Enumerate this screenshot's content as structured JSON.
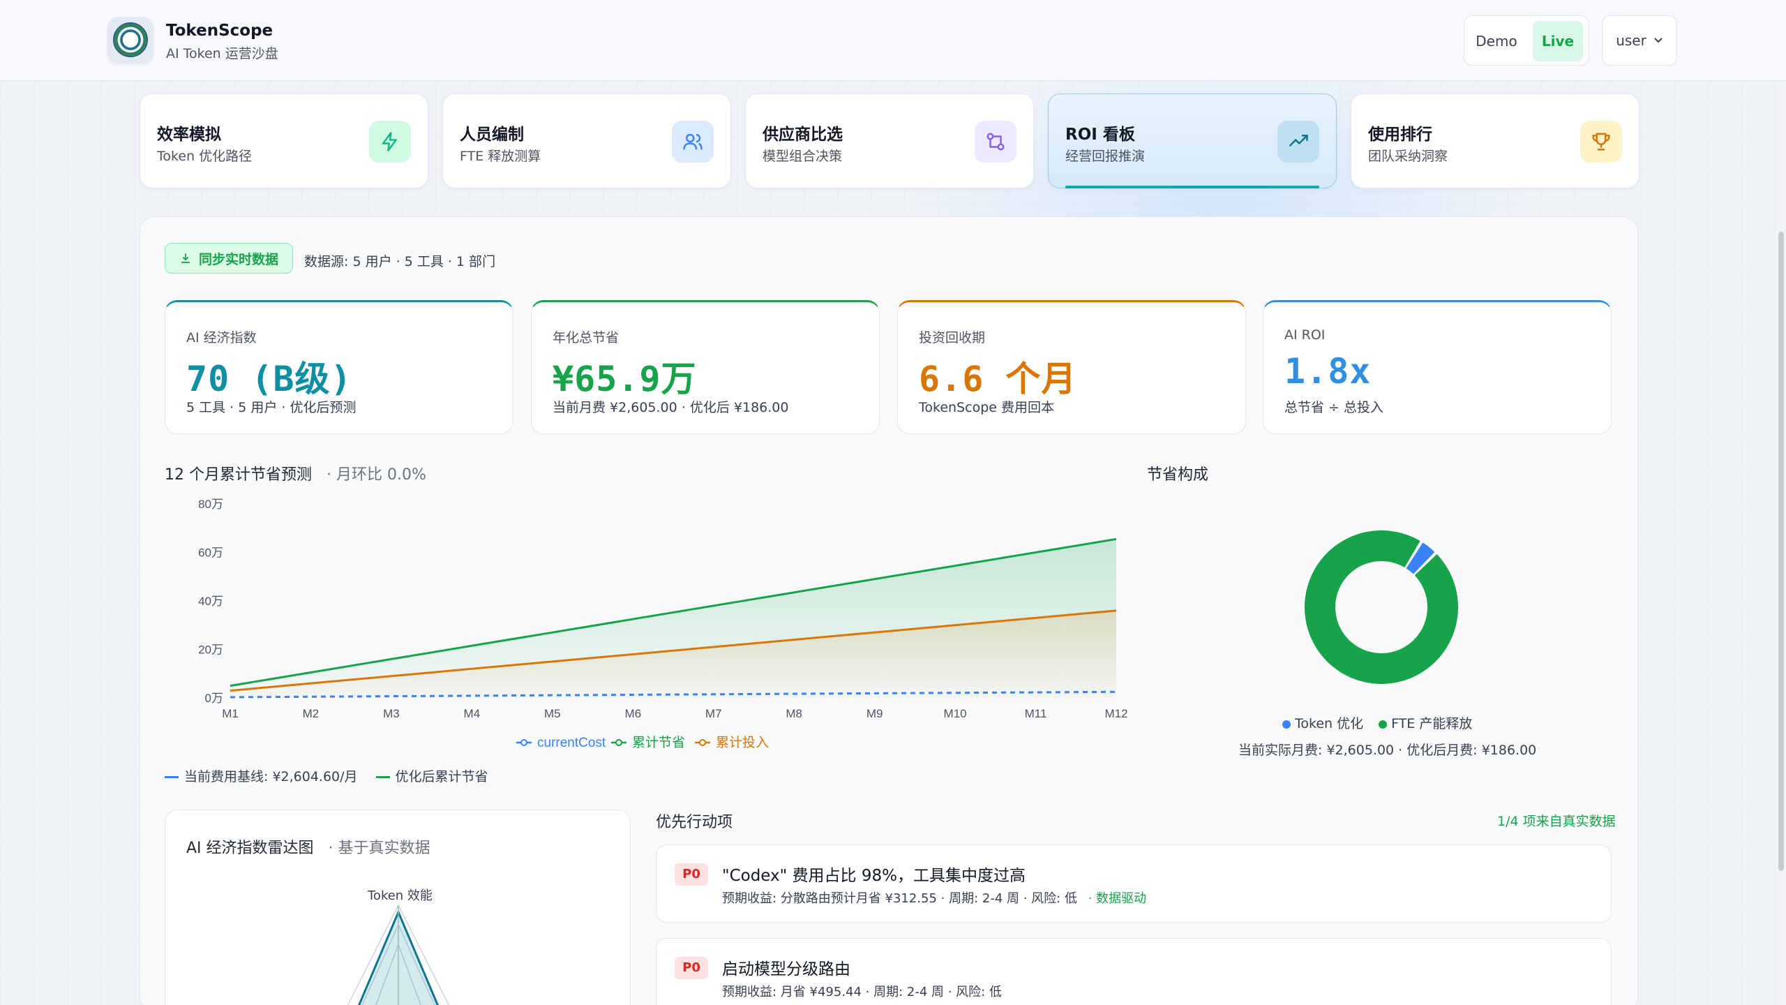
{
  "app": {
    "name": "TokenScope",
    "subtitle": "AI Token 运营沙盘",
    "mode_demo": "Demo",
    "mode_live": "Live",
    "user": "user"
  },
  "nav": [
    {
      "title": "效率模拟",
      "sub": "Token 优化路径",
      "icon": "lightning-icon",
      "color": "#10b981"
    },
    {
      "title": "人员编制",
      "sub": "FTE 释放测算",
      "icon": "users-icon",
      "color": "#3b82f6"
    },
    {
      "title": "供应商比选",
      "sub": "模型组合决策",
      "icon": "git-compare-icon",
      "color": "#8b5cf6"
    },
    {
      "title": "ROI 看板",
      "sub": "经营回报推演",
      "icon": "trending-up-icon",
      "color": "#0e7490"
    },
    {
      "title": "使用排行",
      "sub": "团队采纳洞察",
      "icon": "trophy-icon",
      "color": "#d97706"
    }
  ],
  "sync": {
    "label": "同步实时数据",
    "source": "数据源: 5 用户 · 5 工具 · 1 部门"
  },
  "kpis": [
    {
      "label": "AI 经济指数",
      "value": "70 (B级)",
      "desc": "5 工具 · 5 用户 · 优化后预测",
      "color": "#0e8fa3"
    },
    {
      "label": "年化总节省",
      "value": "¥65.9万",
      "desc": "当前月费 ¥2,605.00 · 优化后 ¥186.00",
      "color": "#16a34a"
    },
    {
      "label": "投资回收期",
      "value": "6.6 个月",
      "desc": "TokenScope 费用回本",
      "color": "#d97706"
    },
    {
      "label": "AI ROI",
      "value": "1.8x",
      "desc": "总节省 ÷ 总投入",
      "color": "#2f8fe0"
    }
  ],
  "trend": {
    "title": "12 个月累计节省预测",
    "sub": "· 月环比 0.0%",
    "baseline_label": "当前费用基线: ¥2,604.60/月",
    "optimized_label": "优化后累计节省"
  },
  "chart_data": {
    "type": "area",
    "categories": [
      "M1",
      "M2",
      "M3",
      "M4",
      "M5",
      "M6",
      "M7",
      "M8",
      "M9",
      "M10",
      "M11",
      "M12"
    ],
    "y_ticks": [
      "0万",
      "20万",
      "40万",
      "60万",
      "80万"
    ],
    "ylim": [
      0,
      800000
    ],
    "series": [
      {
        "name": "currentCost",
        "color": "#3b82f6",
        "dashed": true,
        "values": [
          3000,
          5000,
          7000,
          9000,
          11000,
          13000,
          15000,
          17000,
          19000,
          21000,
          23000,
          25000
        ]
      },
      {
        "name": "累计节省",
        "color": "#16a34a",
        "values": [
          50000,
          105000,
          160000,
          215000,
          270000,
          325000,
          380000,
          435000,
          490000,
          545000,
          600000,
          655000
        ]
      },
      {
        "name": "累计投入",
        "color": "#d97706",
        "values": [
          30000,
          60000,
          90000,
          120000,
          150000,
          180000,
          210000,
          240000,
          270000,
          300000,
          330000,
          360000
        ]
      }
    ]
  },
  "composition": {
    "title": "节省构成",
    "legend": [
      {
        "name": "Token 优化",
        "color": "#3b82f6"
      },
      {
        "name": "FTE 产能释放",
        "color": "#16a34a"
      }
    ],
    "slices": [
      {
        "name": "Token 优化",
        "pct": 3.8,
        "color": "#3b82f6"
      },
      {
        "name": "FTE 产能释放",
        "pct": 96.2,
        "color": "#16a34a"
      }
    ],
    "caption": "当前实际月费: ¥2,605.00 · 优化后月费: ¥186.00"
  },
  "radar": {
    "title": "AI 经济指数雷达图",
    "sub": "· 基于真实数据",
    "axis_top": "Token 效能"
  },
  "actions": {
    "title": "优先行动项",
    "count_label": "1/4 项来自真实数据",
    "items": [
      {
        "priority": "P0",
        "title": "\"Codex\" 费用占比 98%，工具集中度过高",
        "desc": "预期收益: 分散路由预计月省 ¥312.55 · 周期: 2-4 周 · 风险: 低",
        "tag": "· 数据驱动"
      },
      {
        "priority": "P0",
        "title": "启动模型分级路由",
        "desc": "预期收益: 月省 ¥495.44 · 周期: 2-4 周 · 风险: 低",
        "tag": ""
      }
    ]
  }
}
